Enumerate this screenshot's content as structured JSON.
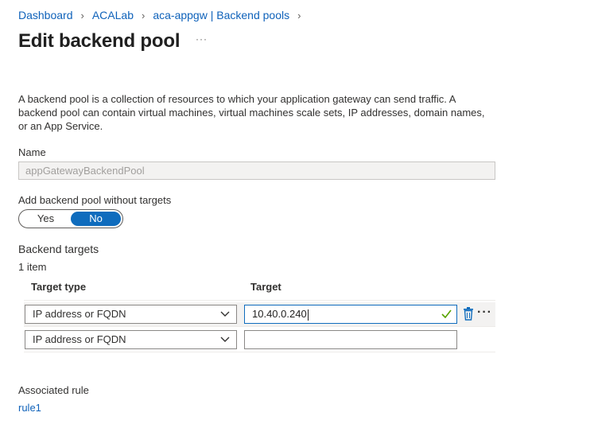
{
  "breadcrumb": [
    "Dashboard",
    "ACALab",
    "aca-appgw | Backend pools"
  ],
  "title": "Edit backend pool",
  "title_more": "···",
  "description": "A backend pool is a collection of resources to which your application gateway can send traffic. A backend pool can contain virtual machines, virtual machines scale sets, IP addresses, domain names, or an App Service.",
  "name": {
    "label": "Name",
    "value": "appGatewayBackendPool"
  },
  "without_targets": {
    "label": "Add backend pool without targets",
    "options": [
      "Yes",
      "No"
    ],
    "selected": "No"
  },
  "backend_targets": {
    "label": "Backend targets",
    "count": "1 item",
    "headers": [
      "Target type",
      "Target"
    ],
    "rows": [
      {
        "type": "IP address or FQDN",
        "target": "10.40.0.240"
      },
      {
        "type": "IP address or FQDN",
        "target": ""
      }
    ]
  },
  "associated_rule": {
    "label": "Associated rule",
    "link": "rule1"
  },
  "colors": {
    "link": "#0f62ba",
    "accent": "#0f6cbd",
    "valid": "#57a300"
  },
  "icons": [
    "chevron-right-icon",
    "chevron-down-icon",
    "checkmark-icon",
    "trash-icon",
    "more-icon"
  ]
}
